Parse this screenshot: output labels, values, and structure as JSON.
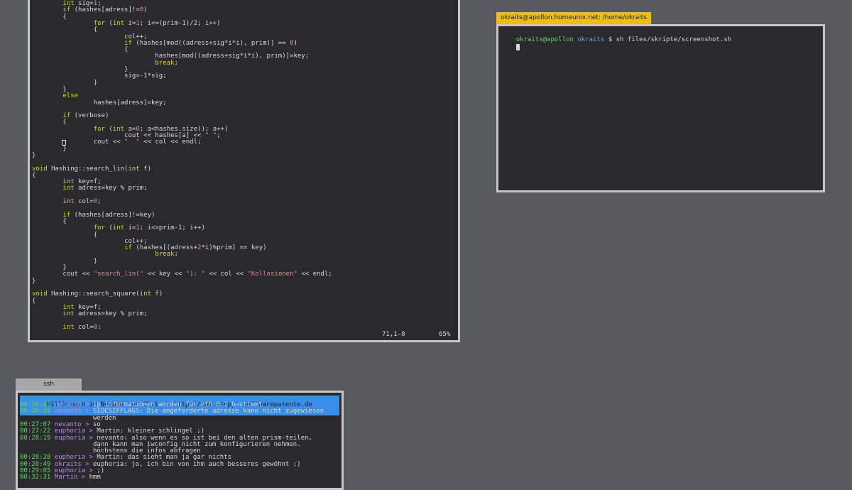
{
  "editor": {
    "lines": [
      "        int sig=1;",
      "        if (hashes[adress]!=0)",
      "        {",
      "                for (int i=1; i<=(prim-1)/2; i++)",
      "                {",
      "                        col++;",
      "                        if (hashes[mod((adress+sig*i*i), prim)] == 0)",
      "                        {",
      "                                hashes[mod((adress+sig*i*i), prim)]=key;",
      "                                break;",
      "                        }",
      "                        sig=-1*sig;",
      "                }",
      "        }",
      "        else",
      "                hashes[adress]=key;",
      "",
      "        if (verbose)",
      "        {",
      "                for (int a=0; a<hashes.size(); a++)",
      "                        cout << hashes[a] << \" \";",
      "                cout << \"  \" << col << endl;",
      "        }",
      "}",
      "",
      "void Hashing::search_lin(int f)",
      "{",
      "        int key=f;",
      "        int adress=key % prim;",
      "",
      "        int col=0;",
      "",
      "        if (hashes[adress]!=key)",
      "        {",
      "                for (int i=1; i<=prim-1; i++)",
      "                {",
      "                        col++;",
      "                        if (hashes[(adress+2*i)%prim] == key)",
      "                                break;",
      "                }",
      "        }",
      "        cout << \"search_lin(\" << key << \"): \" << col << \"Kollosionen\" << endl;",
      "}",
      "",
      "void Hashing::search_square(int f)",
      "{",
      "        int key=f;",
      "        int adress=key % prim;",
      "",
      "        int col=0;"
    ],
    "position": "71,1-8",
    "percent": "65%"
  },
  "terminal": {
    "title": "okraits@apollon.homeunix.net: /home/okraits",
    "prompt_user": "okraits@apollon",
    "prompt_dir": "okraits",
    "prompt_symbol": "$",
    "command": "sh files/skripte/screenshot.sh"
  },
  "chat": {
    "tab_label": "ssh",
    "topic": " Willkommen im Newbie-net-Chat -- http://www.stoppt-softwarepatente.de",
    "messages": [
      {
        "time": "00:26:43",
        "nick": "nevanto",
        "text": "ip informationen werden für eth 0:1 bestimmt"
      },
      {
        "time": "00:26:59",
        "nick": "nevanto",
        "text": "SIOCSIFFLAGS: Die angeforderte adresse kann nicht zugewiesen"
      },
      {
        "time": "",
        "nick": "",
        "text": "werden"
      },
      {
        "time": "00:27:07",
        "nick": "nevanto",
        "text": "so"
      },
      {
        "time": "00:27:22",
        "nick": "euphoria",
        "text": "Martin: kleiner schlingel ;)"
      },
      {
        "time": "00:28:19",
        "nick": "euphoria",
        "text": "nevanto: also wenn es so ist bei den alten prism-teilen,"
      },
      {
        "time": "",
        "nick": "",
        "text": "dann kann man iwconfig nicht zum konfigurieren nehmen."
      },
      {
        "time": "",
        "nick": "",
        "text": "höchstens die infos abfragen"
      },
      {
        "time": "00:28:28",
        "nick": "euphoria",
        "text": "Martin: das sieht man ja gar nichts"
      },
      {
        "time": "00:28:49",
        "nick": "okraits",
        "text": "euphoria: jo, ich bin von ihm auch besseres gewöhnt ;)"
      },
      {
        "time": "00:29:05",
        "nick": "euphoria",
        "text": ";)"
      },
      {
        "time": "00:32:31",
        "nick": "Martin",
        "text": "hmm"
      }
    ]
  },
  "colors": {
    "keyword": "#d8d81e",
    "string": "#e08a8a",
    "number": "#e08a8a",
    "time": "#5fd95f",
    "nick": "#b98ae6",
    "prompt_user": "#5fd95f",
    "prompt_dir": "#6fa0e6",
    "tab_active": "#f0c000",
    "topic_bg": "#3a8ee6"
  }
}
